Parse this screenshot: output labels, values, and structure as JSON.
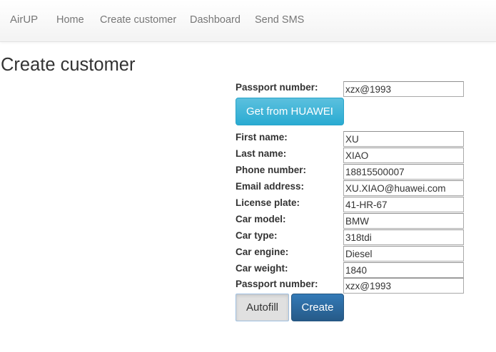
{
  "navbar": {
    "brand": "AirUP",
    "links": [
      {
        "label": "Home"
      },
      {
        "label": "Create customer"
      },
      {
        "label": "Dashboard"
      },
      {
        "label": "Send SMS"
      }
    ]
  },
  "page": {
    "title": "Create customer"
  },
  "lookup": {
    "passport_label": "Passport number:",
    "passport_value": "xzx@1993",
    "fetch_button": "Get from HUAWEI"
  },
  "form": {
    "fields": [
      {
        "label": "First name:",
        "value": "XU"
      },
      {
        "label": "Last name:",
        "value": "XIAO"
      },
      {
        "label": "Phone number:",
        "value": "18815500007"
      },
      {
        "label": "Email address:",
        "value": "XU.XIAO@huawei.com"
      },
      {
        "label": "License plate:",
        "value": "41-HR-67"
      },
      {
        "label": "Car model:",
        "value": "BMW"
      },
      {
        "label": "Car type:",
        "value": "318tdi"
      },
      {
        "label": "Car engine:",
        "value": "Diesel"
      },
      {
        "label": "Car weight:",
        "value": "1840"
      },
      {
        "label": "Passport number:",
        "value": "xzx@1993"
      }
    ],
    "autofill_button": "Autofill",
    "create_button": "Create"
  }
}
